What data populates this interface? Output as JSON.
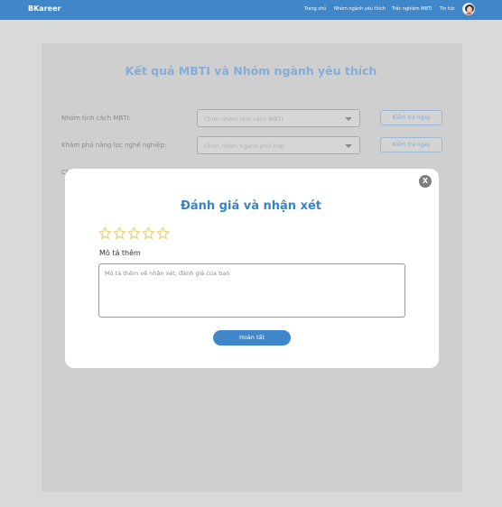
{
  "header": {
    "logo": "BKareer",
    "nav": [
      {
        "label": "Trang chủ"
      },
      {
        "label": "Nhóm ngành yêu thích"
      },
      {
        "label": "Trắc nghiệm MBTI"
      },
      {
        "label": "Tin tức"
      }
    ],
    "avatar_icon": "user-avatar-icon"
  },
  "page": {
    "title": "Kết quả MBTI và Nhóm ngành yêu thích",
    "rows": [
      {
        "label": "Nhóm tính cách MBTI:",
        "select_value": "Chọn nhóm tính cách MBTI",
        "button": "Kiểm tra ngay"
      },
      {
        "label": "Khám phá năng lực nghề nghiệp:",
        "select_value": "Chọn nhóm ngành phù hợp",
        "button": "Kiểm tra ngay"
      }
    ],
    "partial_label": "Ch"
  },
  "modal": {
    "title": "Đánh giá và nhận xét",
    "rating": {
      "value": 0,
      "max": 5
    },
    "description_label": "Mô tả thêm",
    "description_placeholder": "Mô tả thêm về nhận xét, đánh giá của bạn",
    "description_value": "",
    "submit_label": "Hoàn tất",
    "close_label": "X"
  },
  "colors": {
    "primary": "#3f87c9",
    "title_faded": "#86add6",
    "star_outline": "#f2c94c",
    "overlay": "#d9d9d9"
  }
}
